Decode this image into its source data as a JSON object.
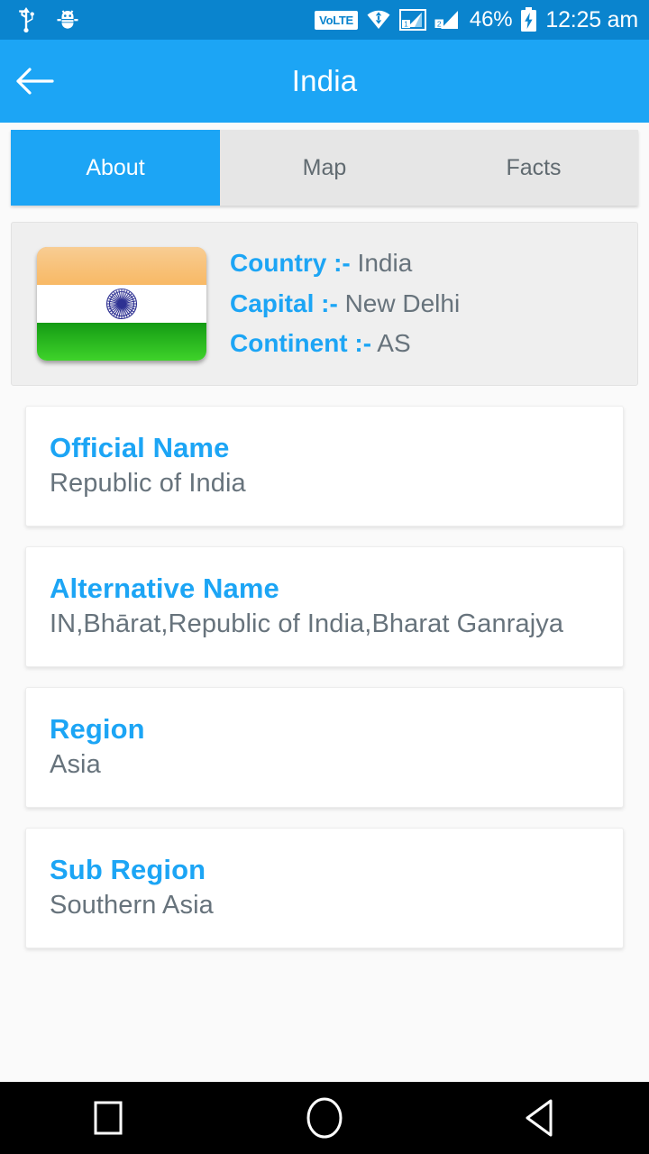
{
  "status_bar": {
    "left_icons": [
      {
        "name": "usb-icon",
        "label": "USB"
      },
      {
        "name": "android-debug-bug-icon",
        "label": "Debug"
      }
    ],
    "volte_label": "VoLTE",
    "right_icons": [
      {
        "name": "wifi-icon",
        "label": "Wi-Fi"
      },
      {
        "name": "signal-sim1-icon",
        "label": "1"
      },
      {
        "name": "signal-sim2-icon",
        "label": "2"
      }
    ],
    "battery_percent": "46%",
    "battery_icon": "battery-charging-icon",
    "clock": "12:25 am",
    "background_color": "#0A84CE"
  },
  "app_bar": {
    "back_icon": "arrow-left-icon",
    "title": "India",
    "background_color": "#1CA5F5"
  },
  "tabs": {
    "active_index": 0,
    "items": [
      {
        "label": "About"
      },
      {
        "label": "Map"
      },
      {
        "label": "Facts"
      }
    ],
    "active_color": "#1CA5F5",
    "inactive_background": "#E6E6E6",
    "inactive_text_color": "#606A70"
  },
  "header_card": {
    "flag": {
      "name": "india-flag-icon",
      "saffron": "#F3A43C",
      "white": "#FFFFFF",
      "green": "#149B14",
      "chakra_color": "#2E3192"
    },
    "rows": [
      {
        "label": "Country :-",
        "value": "India"
      },
      {
        "label": "Capital :-",
        "value": "New Delhi"
      },
      {
        "label": "Continent :-",
        "value": "AS"
      }
    ]
  },
  "info_cards": [
    {
      "title": "Official Name",
      "value": "Republic of India"
    },
    {
      "title": "Alternative Name",
      "value": "IN,Bhārat,Republic of India,Bharat Ganrajya"
    },
    {
      "title": "Region",
      "value": "Asia"
    },
    {
      "title": "Sub Region",
      "value": "Southern Asia"
    }
  ],
  "nav_bar": {
    "buttons": [
      {
        "name": "recents-button",
        "icon": "square-icon"
      },
      {
        "name": "home-button",
        "icon": "circle-icon"
      },
      {
        "name": "back-button",
        "icon": "triangle-left-icon"
      }
    ],
    "background_color": "#000000"
  },
  "theme": {
    "accent": "#1CA5F5",
    "value_text": "#67737C",
    "page_background": "#FAFAFA"
  }
}
